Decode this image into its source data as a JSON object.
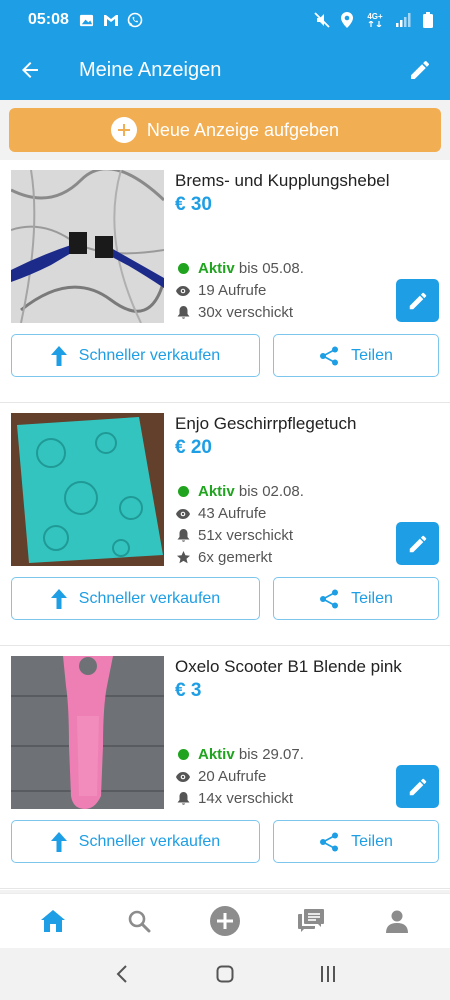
{
  "status_bar": {
    "time": "05:08",
    "network": "4G+"
  },
  "header": {
    "title": "Meine Anzeigen"
  },
  "new_ad": {
    "label": "Neue Anzeige aufgeben"
  },
  "labels": {
    "active": "Aktiv",
    "faster": "Schneller verkaufen",
    "share": "Teilen"
  },
  "ads": [
    {
      "title": "Brems- und Kupplungshebel",
      "price": "€ 30",
      "until": "bis 05.08.",
      "views": "19 Aufrufe",
      "sent": "30x verschickt"
    },
    {
      "title": "Enjo Geschirrpflegetuch",
      "price": "€ 20",
      "until": "bis 02.08.",
      "views": "43 Aufrufe",
      "sent": "51x verschickt",
      "saved": "6x gemerkt"
    },
    {
      "title": "Oxelo Scooter B1 Blende pink",
      "price": "€ 3",
      "until": "bis 29.07.",
      "views": "20 Aufrufe",
      "sent": "14x verschickt"
    }
  ],
  "icons": {
    "back": "arrow-left-icon",
    "edit": "pencil-icon",
    "plus": "plus-circle-icon",
    "eye": "eye-icon",
    "bell": "bell-icon",
    "star": "star-icon",
    "arrow_up": "arrow-up-icon",
    "share": "share-icon",
    "home": "home-icon",
    "search": "search-icon",
    "add": "add-circle-icon",
    "messages": "messages-icon",
    "profile": "profile-icon"
  },
  "colors": {
    "primary": "#1e9ee4",
    "accent": "#f2ae53",
    "active": "#20a41f"
  }
}
